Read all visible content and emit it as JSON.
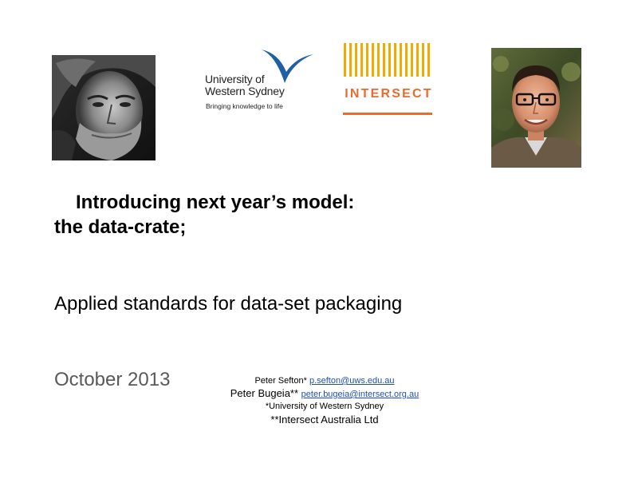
{
  "title": {
    "line1": "Introducing next year’s model:",
    "line2": "the data-crate;"
  },
  "subtitle": "Applied standards for data-set packaging",
  "date": "October 2013",
  "logos": {
    "uws": {
      "name_line1": "University of",
      "name_line2": "Western Sydney",
      "tagline": "Bringing knowledge to life",
      "color": "#1f5fa8"
    },
    "intersect": {
      "name": "INTERSECT",
      "color": "#ec6a2b"
    }
  },
  "authors": [
    {
      "name": "Peter Sefton*",
      "email": "p.sefton@uws.edu.au"
    },
    {
      "name": "Peter Bugeia**",
      "email": "peter.bugeia@intersect.org.au"
    }
  ],
  "affiliations": [
    "*University of Western Sydney",
    "**Intersect Australia Ltd"
  ]
}
